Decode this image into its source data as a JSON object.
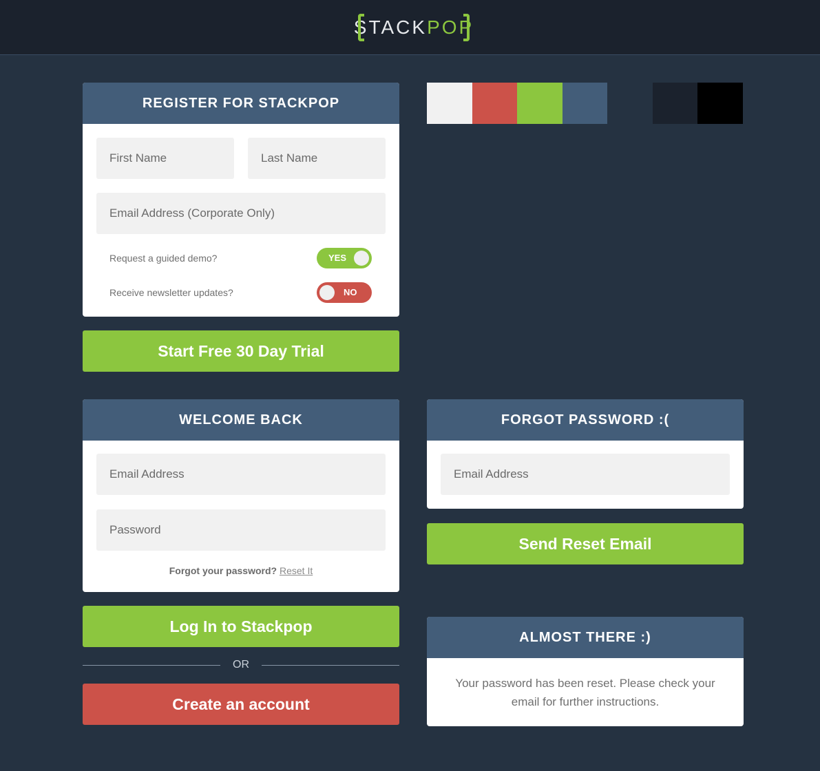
{
  "header": {
    "logo_left": "STACK",
    "logo_right": "POP"
  },
  "register": {
    "title": "REGISTER FOR STACKPOP",
    "first_name_placeholder": "First Name",
    "last_name_placeholder": "Last Name",
    "email_placeholder": "Email Address (Corporate Only)",
    "demo_label": "Request a guided demo?",
    "demo_toggle": "YES",
    "newsletter_label": "Receive newsletter updates?",
    "newsletter_toggle": "NO",
    "submit_label": "Start Free 30 Day Trial"
  },
  "palette": {
    "colors": [
      "#f1f1f1",
      "#cc5249",
      "#8cc63f",
      "#435d79",
      "#253241",
      "#1b222d",
      "#000000"
    ]
  },
  "login": {
    "title": "WELCOME BACK",
    "email_placeholder": "Email Address",
    "password_placeholder": "Password",
    "forgot_prefix": "Forgot your password?",
    "forgot_link": "Reset It",
    "submit_label": "Log In to Stackpop",
    "or_label": "OR",
    "create_label": "Create an account"
  },
  "forgot": {
    "title": "FORGOT PASSWORD :(",
    "email_placeholder": "Email Address",
    "submit_label": "Send Reset Email"
  },
  "almost": {
    "title": "ALMOST THERE :)",
    "message": "Your password has been reset. Please check your email for further instructions."
  },
  "colors": {
    "accent_green": "#8cc63f",
    "accent_red": "#cc5249",
    "header_blue": "#435d79",
    "background": "#253241"
  }
}
